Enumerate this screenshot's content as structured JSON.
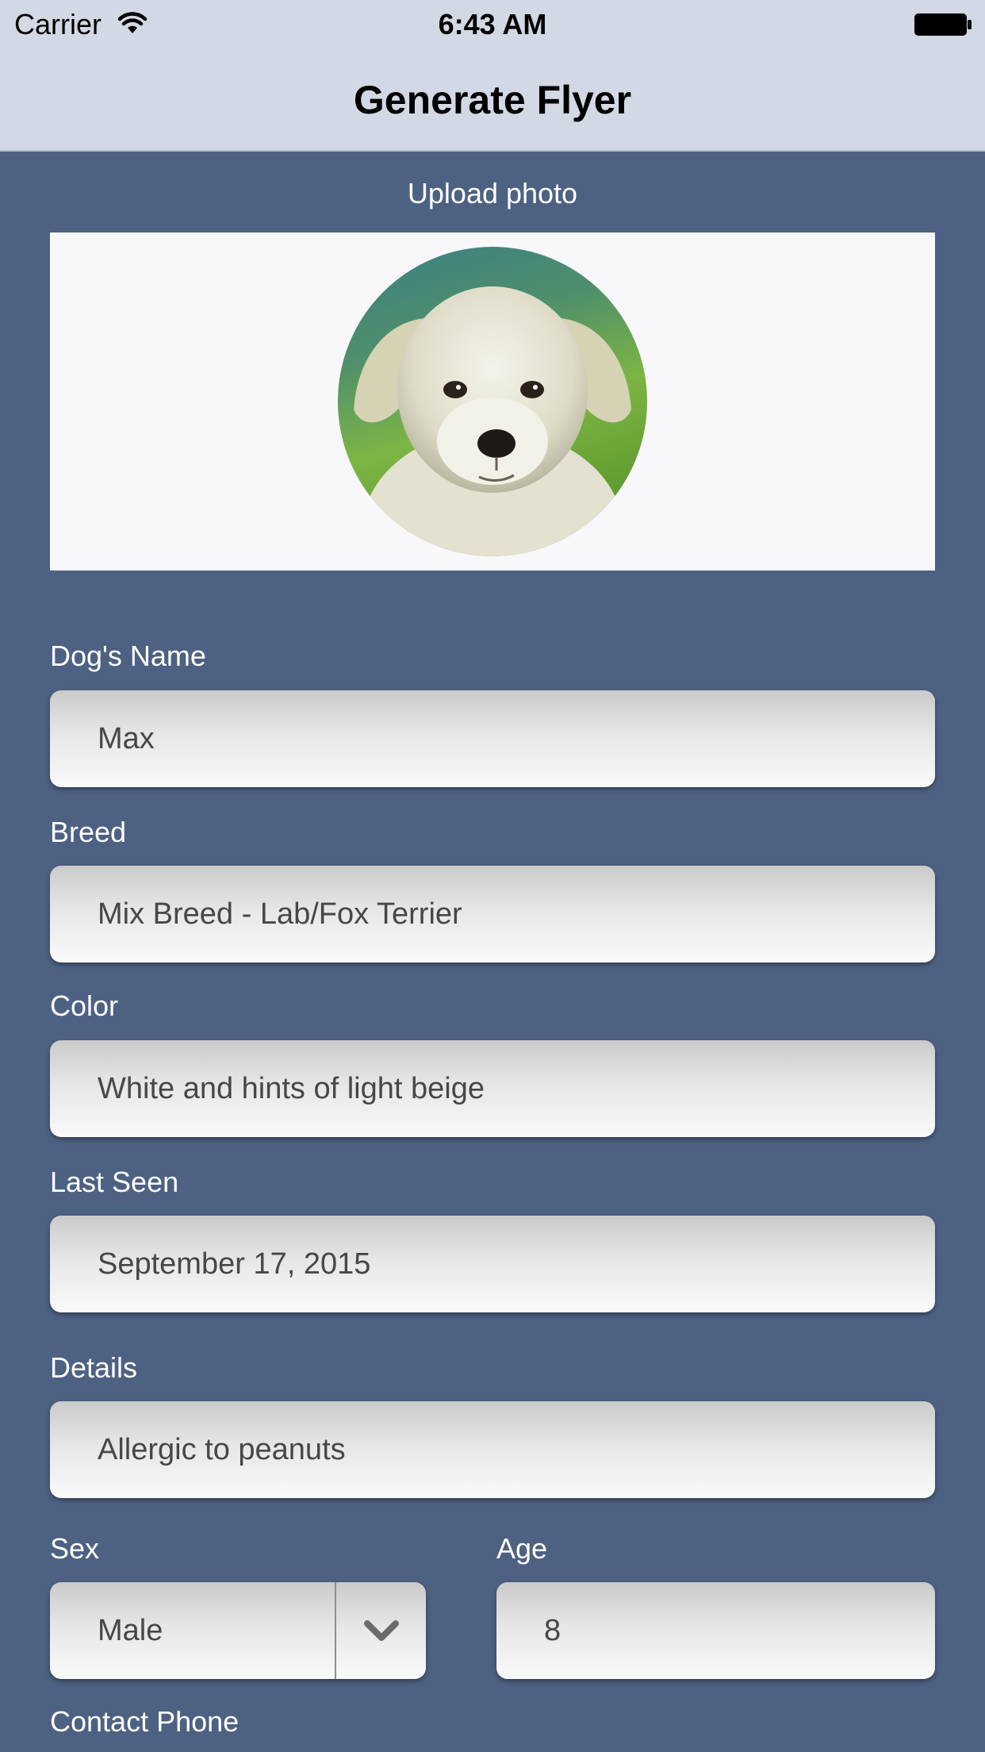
{
  "status_bar": {
    "carrier": "Carrier",
    "time": "6:43 AM",
    "icons": [
      "wifi-icon",
      "battery-icon"
    ]
  },
  "nav": {
    "title": "Generate Flyer"
  },
  "photo": {
    "upload_label": "Upload photo",
    "subject": "white puppy photo"
  },
  "form": {
    "dogs_name": {
      "label": "Dog's Name",
      "value": "Max"
    },
    "breed": {
      "label": "Breed",
      "value": "Mix Breed - Lab/Fox Terrier"
    },
    "color": {
      "label": "Color",
      "value": "White and hints of light beige"
    },
    "last_seen": {
      "label": "Last Seen",
      "value": "September 17, 2015"
    },
    "details": {
      "label": "Details",
      "value": "Allergic to peanuts"
    },
    "sex": {
      "label": "Sex",
      "value": "Male",
      "icon": "chevron-down-icon"
    },
    "age": {
      "label": "Age",
      "value": "8"
    },
    "contact_phone": {
      "label": "Contact Phone"
    }
  },
  "colors": {
    "background": "#4d6182",
    "bars": "#d3d8e5",
    "photo_box": "#f8f7fa",
    "field_text": "#474747"
  }
}
